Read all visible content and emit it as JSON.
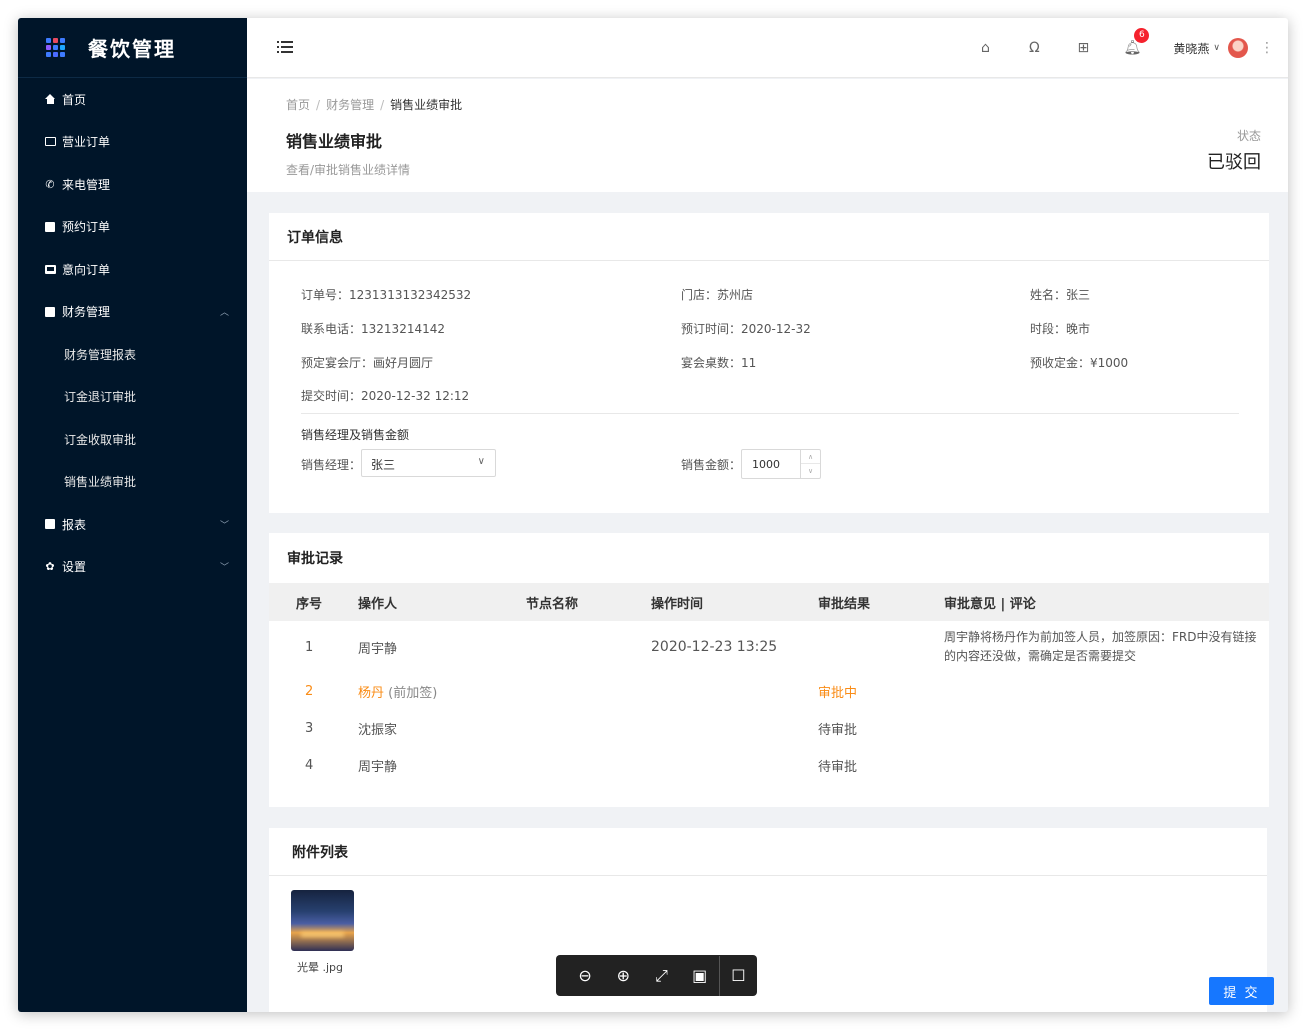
{
  "app": {
    "title": "餐饮管理"
  },
  "sidebar": {
    "items": [
      {
        "label": "首页"
      },
      {
        "label": "营业订单"
      },
      {
        "label": "来电管理"
      },
      {
        "label": "预约订单"
      },
      {
        "label": "意向订单"
      },
      {
        "label": "财务管理",
        "expanded": true,
        "children": [
          {
            "label": "财务管理报表"
          },
          {
            "label": "订金退订审批"
          },
          {
            "label": "订金收取审批"
          },
          {
            "label": "销售业绩审批"
          }
        ]
      },
      {
        "label": "报表"
      },
      {
        "label": "设置"
      }
    ]
  },
  "header": {
    "notification_count": "6",
    "user_name": "黄晓燕"
  },
  "breadcrumb": [
    "首页",
    "财务管理",
    "销售业绩审批"
  ],
  "page": {
    "title": "销售业绩审批",
    "description": "查看/审批销售业绩详情",
    "status_label": "状态",
    "status_value": "已驳回"
  },
  "order_info": {
    "title": "订单信息",
    "fields": {
      "order_no": {
        "key": "订单号：",
        "value": "1231313132342532"
      },
      "store": {
        "key": "门店：",
        "value": "苏州店"
      },
      "name": {
        "key": "姓名：",
        "value": "张三"
      },
      "phone": {
        "key": "联系电话：",
        "value": "13213214142"
      },
      "booking_time": {
        "key": "预订时间：",
        "value": "2020-12-32"
      },
      "period": {
        "key": "时段：",
        "value": "晚市"
      },
      "hall": {
        "key": "预定宴会厅：",
        "value": "画好月圆厅"
      },
      "tables": {
        "key": "宴会桌数：",
        "value": "11"
      },
      "deposit": {
        "key": "预收定金：",
        "value": "¥1000"
      },
      "submit_time": {
        "key": "提交时间：",
        "value": "2020-12-32 12:12"
      }
    },
    "sales_section_title": "销售经理及销售金额",
    "manager_label": "销售经理：",
    "manager_value": "张三",
    "amount_label": "销售金额：",
    "amount_value": "1000"
  },
  "approval": {
    "title": "审批记录",
    "columns": [
      "序号",
      "操作人",
      "节点名称",
      "操作时间",
      "审批结果",
      "审批意见 | 评论"
    ],
    "rows": [
      {
        "index": "1",
        "operator": "周宇静",
        "operator_note": "",
        "node": "",
        "time": "2020-12-23 13:25",
        "result": "",
        "comment": "周宇静将杨丹作为前加签人员，加签原因：FRD中没有链接的内容还没做，需确定是否需要提交"
      },
      {
        "index": "2",
        "operator": "杨丹",
        "operator_note": "(前加签)",
        "node": "",
        "time": "",
        "result": "审批中",
        "comment": ""
      },
      {
        "index": "3",
        "operator": "沈振家",
        "operator_note": "",
        "node": "",
        "time": "",
        "result": "待审批",
        "comment": ""
      },
      {
        "index": "4",
        "operator": "周宇静",
        "operator_note": "",
        "node": "",
        "time": "",
        "result": "待审批",
        "comment": ""
      }
    ]
  },
  "attachments": {
    "title": "附件列表",
    "files": [
      {
        "name": "光晕 .jpg"
      }
    ]
  },
  "actions": {
    "submit": "提 交"
  },
  "colors": {
    "sidebar_bg": "#001529",
    "primary": "#1677ff",
    "active_row": "#fa8c16",
    "badge": "#f5222d"
  }
}
